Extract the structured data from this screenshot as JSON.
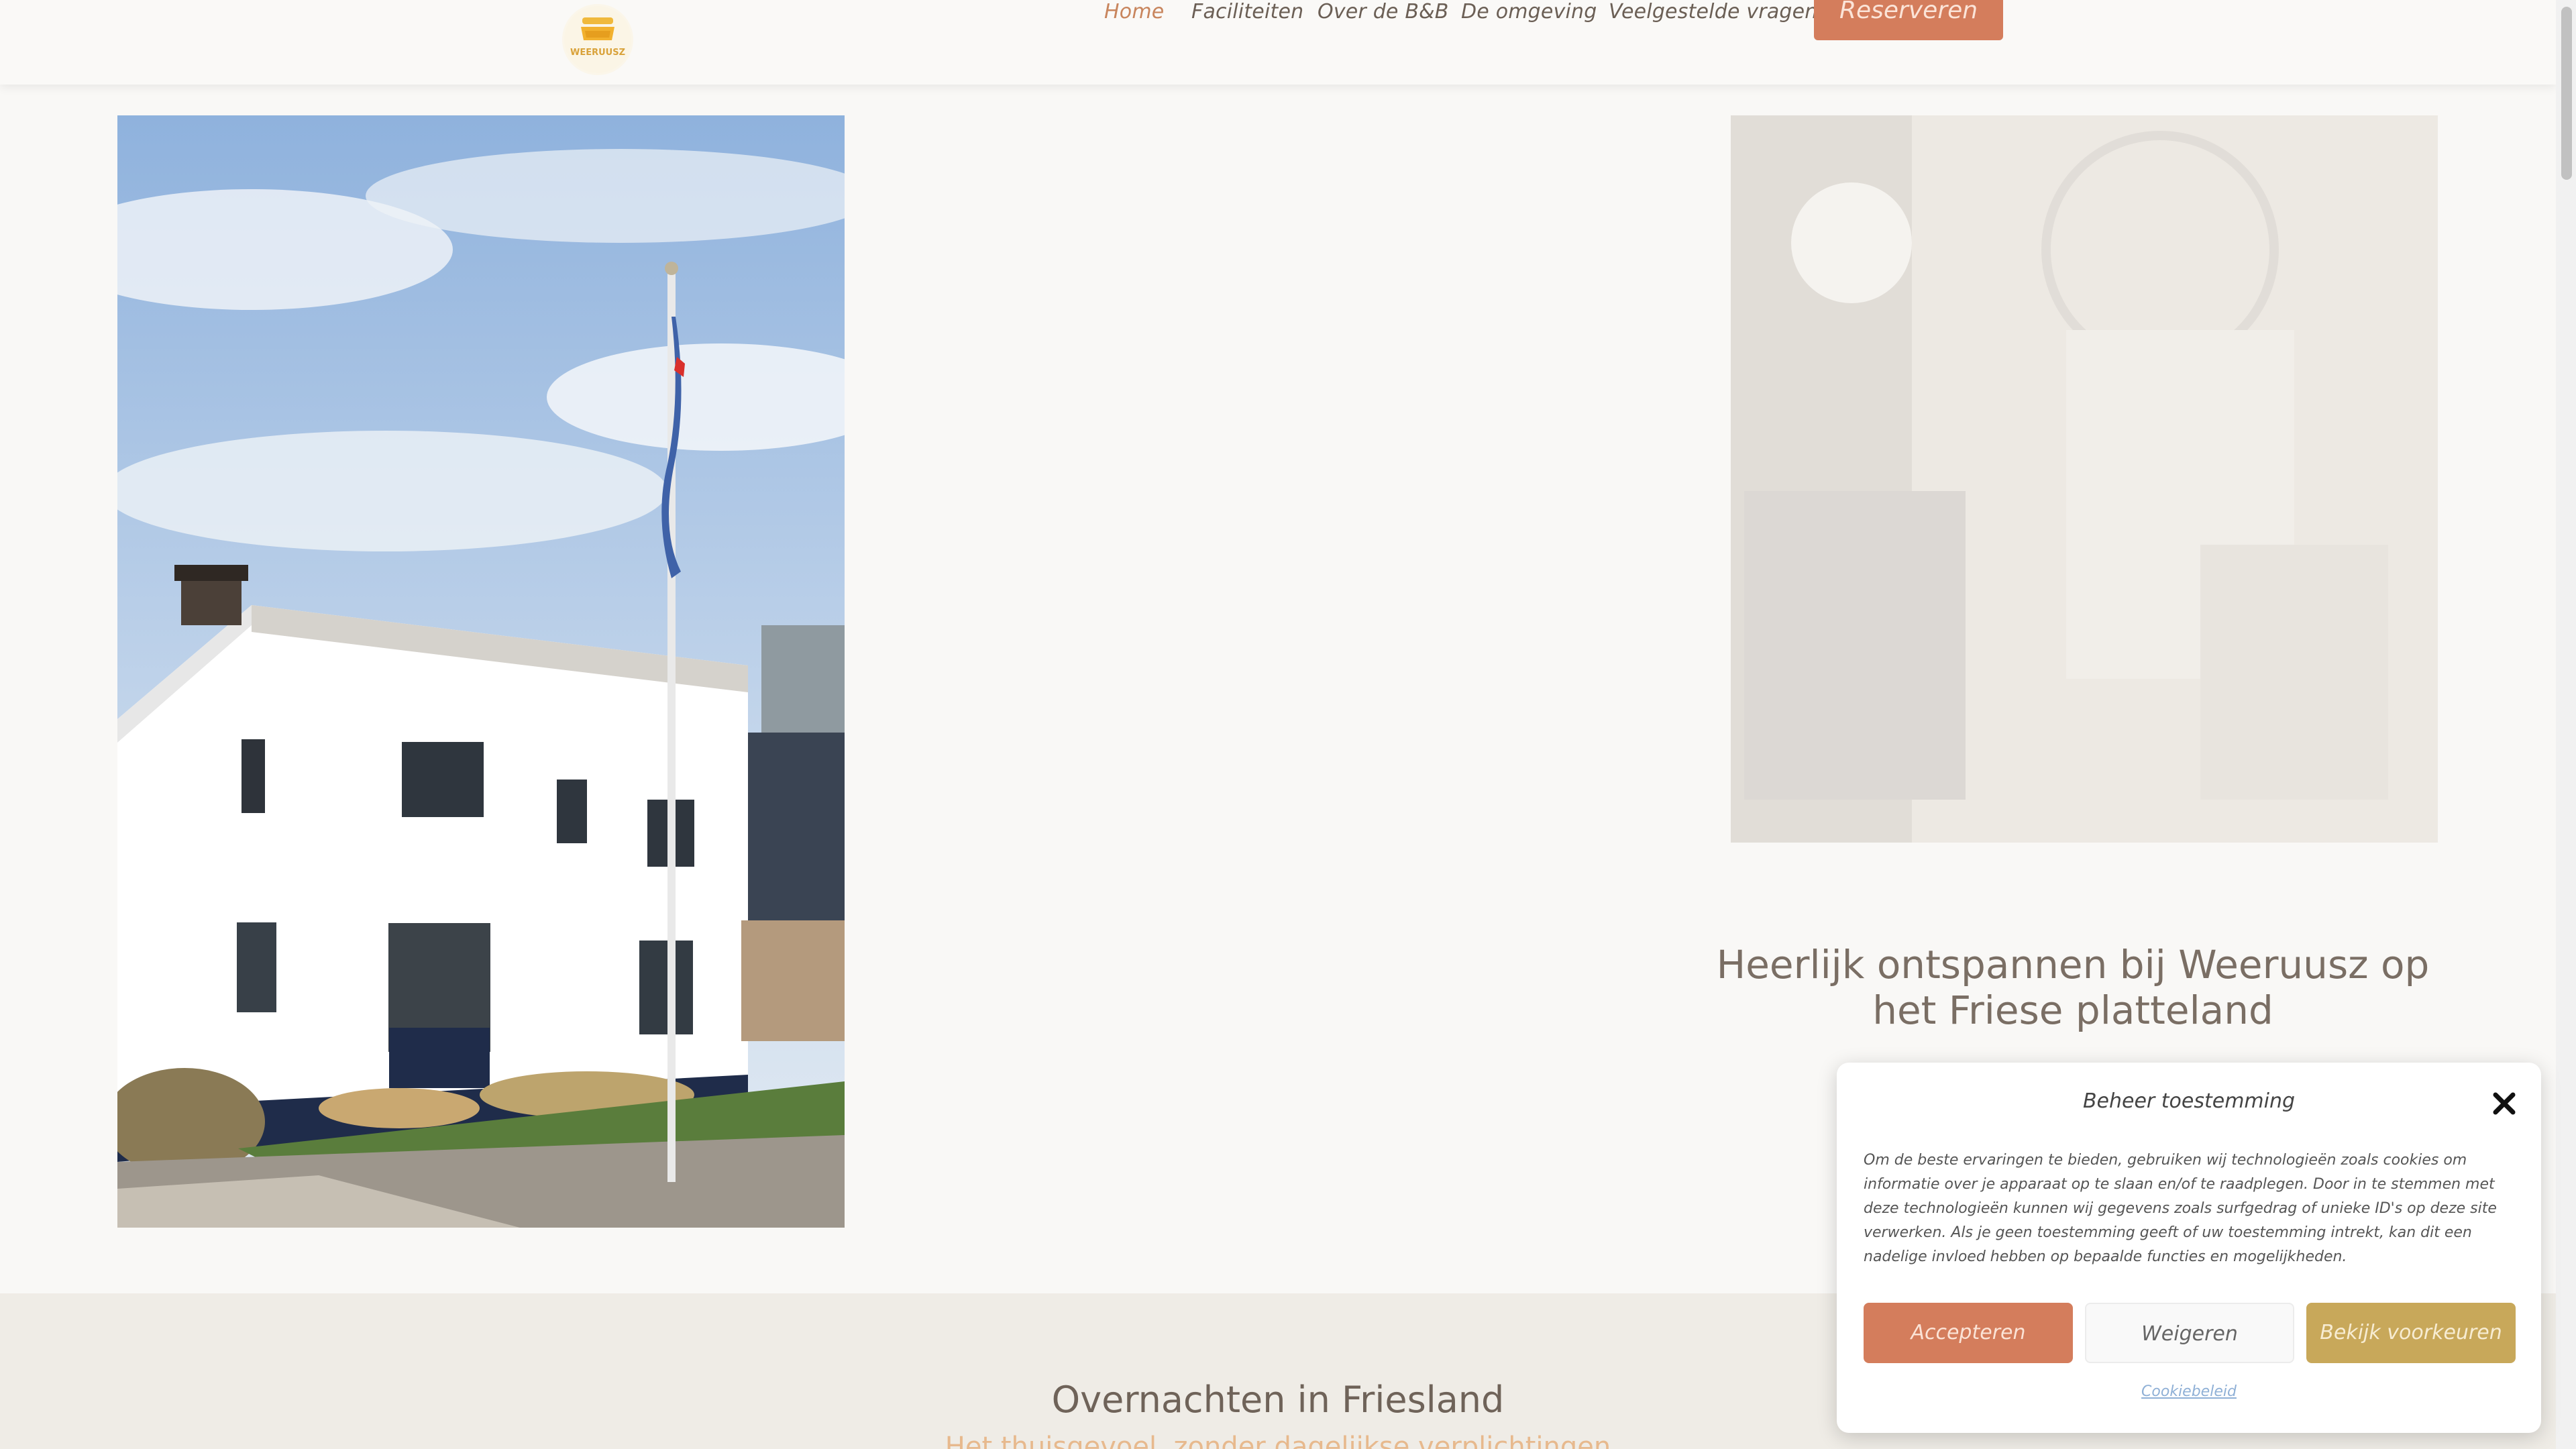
{
  "header": {
    "logo_text": "WEERUUSZ",
    "nav": [
      {
        "label": "Home",
        "active": true
      },
      {
        "label": "Faciliteiten",
        "active": false
      },
      {
        "label": "Over de B&B",
        "active": false
      },
      {
        "label": "De omgeving",
        "active": false
      },
      {
        "label": "Veelgestelde vragen",
        "active": false
      }
    ],
    "reserve_label": "Reserveren"
  },
  "hero": {
    "title": "Heerlijk ontspannen bij Weeruusz op het Friese platteland"
  },
  "section2": {
    "title": "Overnachten in Friesland",
    "subtitle": "Het thuisgevoel, zonder dagelijkse verplichtingen"
  },
  "cookie": {
    "title": "Beheer toestemming",
    "body": "Om de beste ervaringen te bieden, gebruiken wij technologieën zoals cookies om informatie over je apparaat op te slaan en/of te raadplegen. Door in te stemmen met deze technologieën kunnen wij gegevens zoals surfgedrag of unieke ID's op deze site verwerken. Als je geen toestemming geeft of uw toestemming intrekt, kan dit een nadelige invloed hebben op bepaalde functies en mogelijkheden.",
    "accept_label": "Accepteren",
    "decline_label": "Weigeren",
    "prefs_label": "Bekijk voorkeuren",
    "policy_label": "Cookiebeleid"
  },
  "colors": {
    "accent": "#d47d5c",
    "gold": "#c8a85a",
    "background": "#f9f8f6",
    "active_nav": "#c8855d"
  },
  "icons": [
    "close-icon",
    "logo-crown-icon"
  ]
}
